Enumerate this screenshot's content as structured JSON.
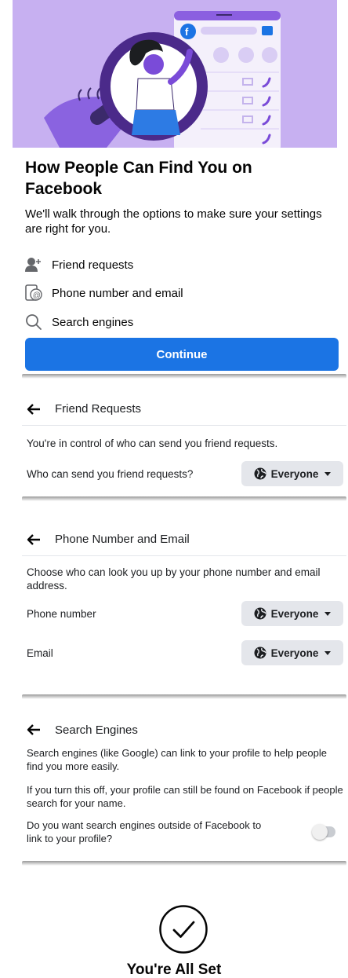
{
  "intro": {
    "title": "How People Can Find You on Facebook",
    "subtitle": "We'll walk through the options to make sure your settings are right for you.",
    "options": [
      {
        "label": "Friend requests",
        "icon": "add-friend-icon"
      },
      {
        "label": "Phone number and email",
        "icon": "phone-email-icon"
      },
      {
        "label": "Search engines",
        "icon": "search-icon"
      }
    ],
    "continue_label": "Continue"
  },
  "friend_requests": {
    "title": "Friend Requests",
    "description": "You're in control of who can send you friend requests.",
    "question": "Who can send you friend requests?",
    "value": "Everyone"
  },
  "phone_email": {
    "title": "Phone Number and Email",
    "description": "Choose who can look you up by your phone number and email address.",
    "phone_label": "Phone number",
    "phone_value": "Everyone",
    "email_label": "Email",
    "email_value": "Everyone"
  },
  "search_engines": {
    "title": "Search Engines",
    "description1": "Search engines (like Google) can link to your profile to help people find you more easily.",
    "description2": "If you turn this off, your profile can still be found on Facebook if people search for your name.",
    "question": "Do you want search engines outside of Facebook to link to your profile?",
    "toggle_on": false
  },
  "done": {
    "title": "You're All Set"
  },
  "colors": {
    "accent": "#1b74e4",
    "hero_bg": "#c7b0f1",
    "dropdown_bg": "#e4e6eb"
  }
}
